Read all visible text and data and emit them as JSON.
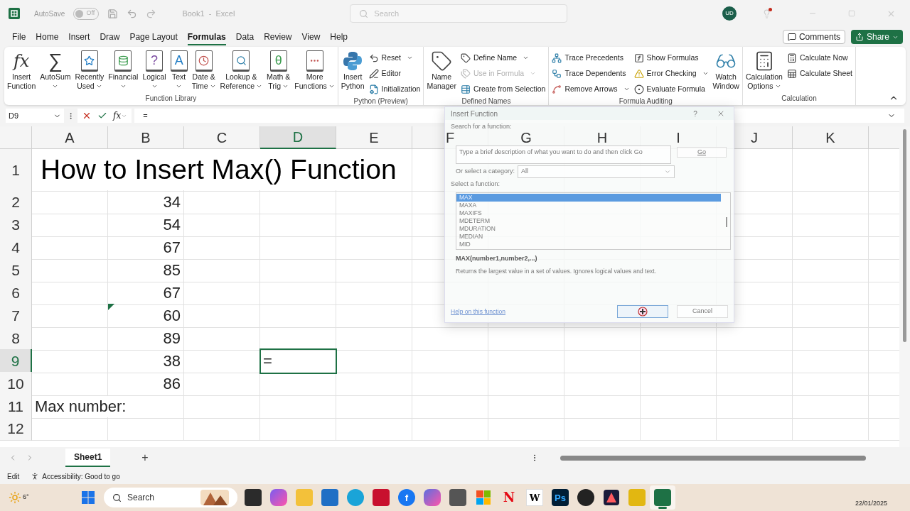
{
  "title_bar": {
    "autosave_label": "AutoSave",
    "autosave": {
      "on": false,
      "label": "Off"
    },
    "document_title": "Book1  -  Excel",
    "search_placeholder": "Search",
    "account_initials": "UD",
    "notification": true
  },
  "menu_tabs": [
    {
      "label": "File",
      "selected": false
    },
    {
      "label": "Home",
      "selected": false
    },
    {
      "label": "Insert",
      "selected": false
    },
    {
      "label": "Draw",
      "selected": false
    },
    {
      "label": "Page Layout",
      "selected": false
    },
    {
      "label": "Formulas",
      "selected": true
    },
    {
      "label": "Data",
      "selected": false
    },
    {
      "label": "Review",
      "selected": false
    },
    {
      "label": "View",
      "selected": false
    },
    {
      "label": "Help",
      "selected": false
    }
  ],
  "header_buttons": [
    {
      "label": "Comments",
      "kind": "outline"
    },
    {
      "label": "Share",
      "kind": "primary"
    }
  ],
  "ribbon": {
    "groups": [
      {
        "label": "Function Library",
        "items": [
          {
            "kind": "large",
            "glyph": "fx",
            "lines": [
              "Insert",
              "Function"
            ],
            "dropdown": false
          },
          {
            "kind": "large",
            "glyph": "∑",
            "lines": [
              "AutoSum"
            ],
            "dropdown": true
          },
          {
            "kind": "large",
            "lines": [
              "Recently",
              "Used"
            ],
            "dropdown": true
          },
          {
            "kind": "large",
            "lines": [
              "Financial"
            ],
            "dropdown": true
          },
          {
            "kind": "large",
            "glyph": "?",
            "lines": [
              "Logical"
            ],
            "dropdown": true
          },
          {
            "kind": "large",
            "glyph": "A",
            "lines": [
              "Text"
            ],
            "dropdown": true
          },
          {
            "kind": "large",
            "lines": [
              "Date &",
              "Time"
            ],
            "dropdown": true
          },
          {
            "kind": "large",
            "lines": [
              "Lookup &",
              "Reference"
            ],
            "dropdown": true
          },
          {
            "kind": "large",
            "glyph": "θ",
            "lines": [
              "Math &",
              "Trig"
            ],
            "dropdown": true
          },
          {
            "kind": "large",
            "lines": [
              "More",
              "Functions"
            ],
            "dropdown": true
          }
        ]
      },
      {
        "label": "Python (Preview)",
        "items": [
          {
            "kind": "large",
            "lines": [
              "Insert",
              "Python"
            ],
            "dropdown": false
          },
          {
            "kind": "stack",
            "items": [
              {
                "label": "Reset",
                "dropdown": true,
                "disabled": false
              },
              {
                "label": "Editor",
                "dropdown": false,
                "disabled": false
              },
              {
                "label": "Initialization",
                "dropdown": false,
                "disabled": false
              }
            ]
          }
        ]
      },
      {
        "label": "Defined Names",
        "items": [
          {
            "kind": "large",
            "lines": [
              "Name",
              "Manager"
            ],
            "dropdown": false
          },
          {
            "kind": "stack",
            "items": [
              {
                "label": "Define Name",
                "dropdown": true,
                "disabled": false
              },
              {
                "label": "Use in Formula",
                "dropdown": true,
                "disabled": true
              },
              {
                "label": "Create from Selection",
                "dropdown": false,
                "disabled": false
              }
            ]
          }
        ]
      },
      {
        "label": "Formula Auditing",
        "items": [
          {
            "kind": "stack",
            "items": [
              {
                "label": "Trace Precedents",
                "dropdown": false,
                "disabled": false
              },
              {
                "label": "Trace Dependents",
                "dropdown": false,
                "disabled": false
              },
              {
                "label": "Remove Arrows",
                "dropdown": true,
                "disabled": false
              }
            ]
          },
          {
            "kind": "stack",
            "items": [
              {
                "label": "Show Formulas",
                "dropdown": false,
                "disabled": false
              },
              {
                "label": "Error Checking",
                "dropdown": true,
                "disabled": false
              },
              {
                "label": "Evaluate Formula",
                "dropdown": false,
                "disabled": false
              }
            ]
          },
          {
            "kind": "large",
            "lines": [
              "Watch",
              "Window"
            ],
            "dropdown": false
          }
        ]
      },
      {
        "label": "Calculation",
        "items": [
          {
            "kind": "large",
            "lines": [
              "Calculation",
              "Options"
            ],
            "dropdown": true
          },
          {
            "kind": "stack",
            "items": [
              {
                "label": "Calculate Now",
                "dropdown": false,
                "disabled": false
              },
              {
                "label": "Calculate Sheet",
                "dropdown": false,
                "disabled": false
              }
            ]
          }
        ]
      }
    ]
  },
  "formula_bar": {
    "name_box": "D9",
    "function_glyph": "fx",
    "formula": "="
  },
  "columns": [
    {
      "label": "A",
      "selected": false
    },
    {
      "label": "B",
      "selected": false
    },
    {
      "label": "C",
      "selected": false
    },
    {
      "label": "D",
      "selected": true
    },
    {
      "label": "E",
      "selected": false
    },
    {
      "label": "F",
      "selected": false
    },
    {
      "label": "G",
      "selected": false
    },
    {
      "label": "H",
      "selected": false
    },
    {
      "label": "I",
      "selected": false
    },
    {
      "label": "J",
      "selected": false
    },
    {
      "label": "K",
      "selected": false
    }
  ],
  "rows": [
    {
      "label": "1",
      "selected": false,
      "cells": [
        {
          "text": "How to Insert Max() Function",
          "kind": "title"
        }
      ]
    },
    {
      "label": "2",
      "selected": false,
      "cells": [
        null,
        {
          "text": "34",
          "kind": "number"
        }
      ]
    },
    {
      "label": "3",
      "selected": false,
      "cells": [
        null,
        {
          "text": "54",
          "kind": "number"
        }
      ]
    },
    {
      "label": "4",
      "selected": false,
      "cells": [
        null,
        {
          "text": "67",
          "kind": "number"
        }
      ]
    },
    {
      "label": "5",
      "selected": false,
      "cells": [
        null,
        {
          "text": "85",
          "kind": "number"
        }
      ]
    },
    {
      "label": "6",
      "selected": false,
      "cells": [
        null,
        {
          "text": "67",
          "kind": "number"
        }
      ]
    },
    {
      "label": "7",
      "selected": false,
      "cells": [
        null,
        {
          "text": "60",
          "kind": "number",
          "error_flag": true
        }
      ]
    },
    {
      "label": "8",
      "selected": false,
      "cells": [
        null,
        {
          "text": "89",
          "kind": "number"
        }
      ]
    },
    {
      "label": "9",
      "selected": true,
      "cells": [
        null,
        {
          "text": "38",
          "kind": "number"
        },
        null,
        {
          "text": "=",
          "kind": "text"
        }
      ]
    },
    {
      "label": "10",
      "selected": false,
      "cells": [
        null,
        {
          "text": "86",
          "kind": "number"
        }
      ]
    },
    {
      "label": "11",
      "selected": false,
      "cells": [
        {
          "text": "Max number:",
          "kind": "text"
        }
      ]
    },
    {
      "label": "12",
      "selected": false,
      "cells": []
    }
  ],
  "dialog": {
    "title": "Insert Function",
    "help": "?",
    "search_label": "Search for a function:",
    "search_placeholder": "Type a brief description of what you want to do and then click Go",
    "go_button": "Go",
    "category_label": "Or select a category:",
    "category": "All",
    "list_label": "Select a function:",
    "functions": [
      {
        "label": "MAX",
        "selected": true
      },
      {
        "label": "MAXA",
        "selected": false
      },
      {
        "label": "MAXIFS",
        "selected": false
      },
      {
        "label": "MDETERM",
        "selected": false
      },
      {
        "label": "MDURATION",
        "selected": false
      },
      {
        "label": "MEDIAN",
        "selected": false
      },
      {
        "label": "MID",
        "selected": false
      }
    ],
    "signature": "MAX(number1,number2,...)",
    "description": "Returns the largest value in a set of values. Ignores logical values and text.",
    "help_link": "Help on this function",
    "cancel_button": "Cancel"
  },
  "sheet_tabs": [
    {
      "label": "Sheet1",
      "selected": true
    }
  ],
  "add_sheet": "+",
  "status_bar": {
    "mode": "Edit",
    "accessibility": "Accessibility: Good to go"
  },
  "taskbar": {
    "weather": "6°",
    "search_placeholder": "Search",
    "date": "22/01/2025",
    "apps": [
      {
        "selected": false
      },
      {
        "selected": false
      },
      {
        "selected": false
      },
      {
        "selected": false
      },
      {
        "selected": false
      },
      {
        "selected": false
      },
      {
        "selected": false,
        "glyph": "f"
      },
      {
        "selected": false
      },
      {
        "selected": false
      },
      {
        "selected": false
      },
      {
        "selected": false,
        "glyph": "N"
      },
      {
        "selected": false,
        "glyph": "W"
      },
      {
        "selected": false,
        "glyph": "Ps"
      },
      {
        "selected": false
      },
      {
        "selected": false
      },
      {
        "selected": false
      },
      {
        "selected": true
      }
    ]
  }
}
